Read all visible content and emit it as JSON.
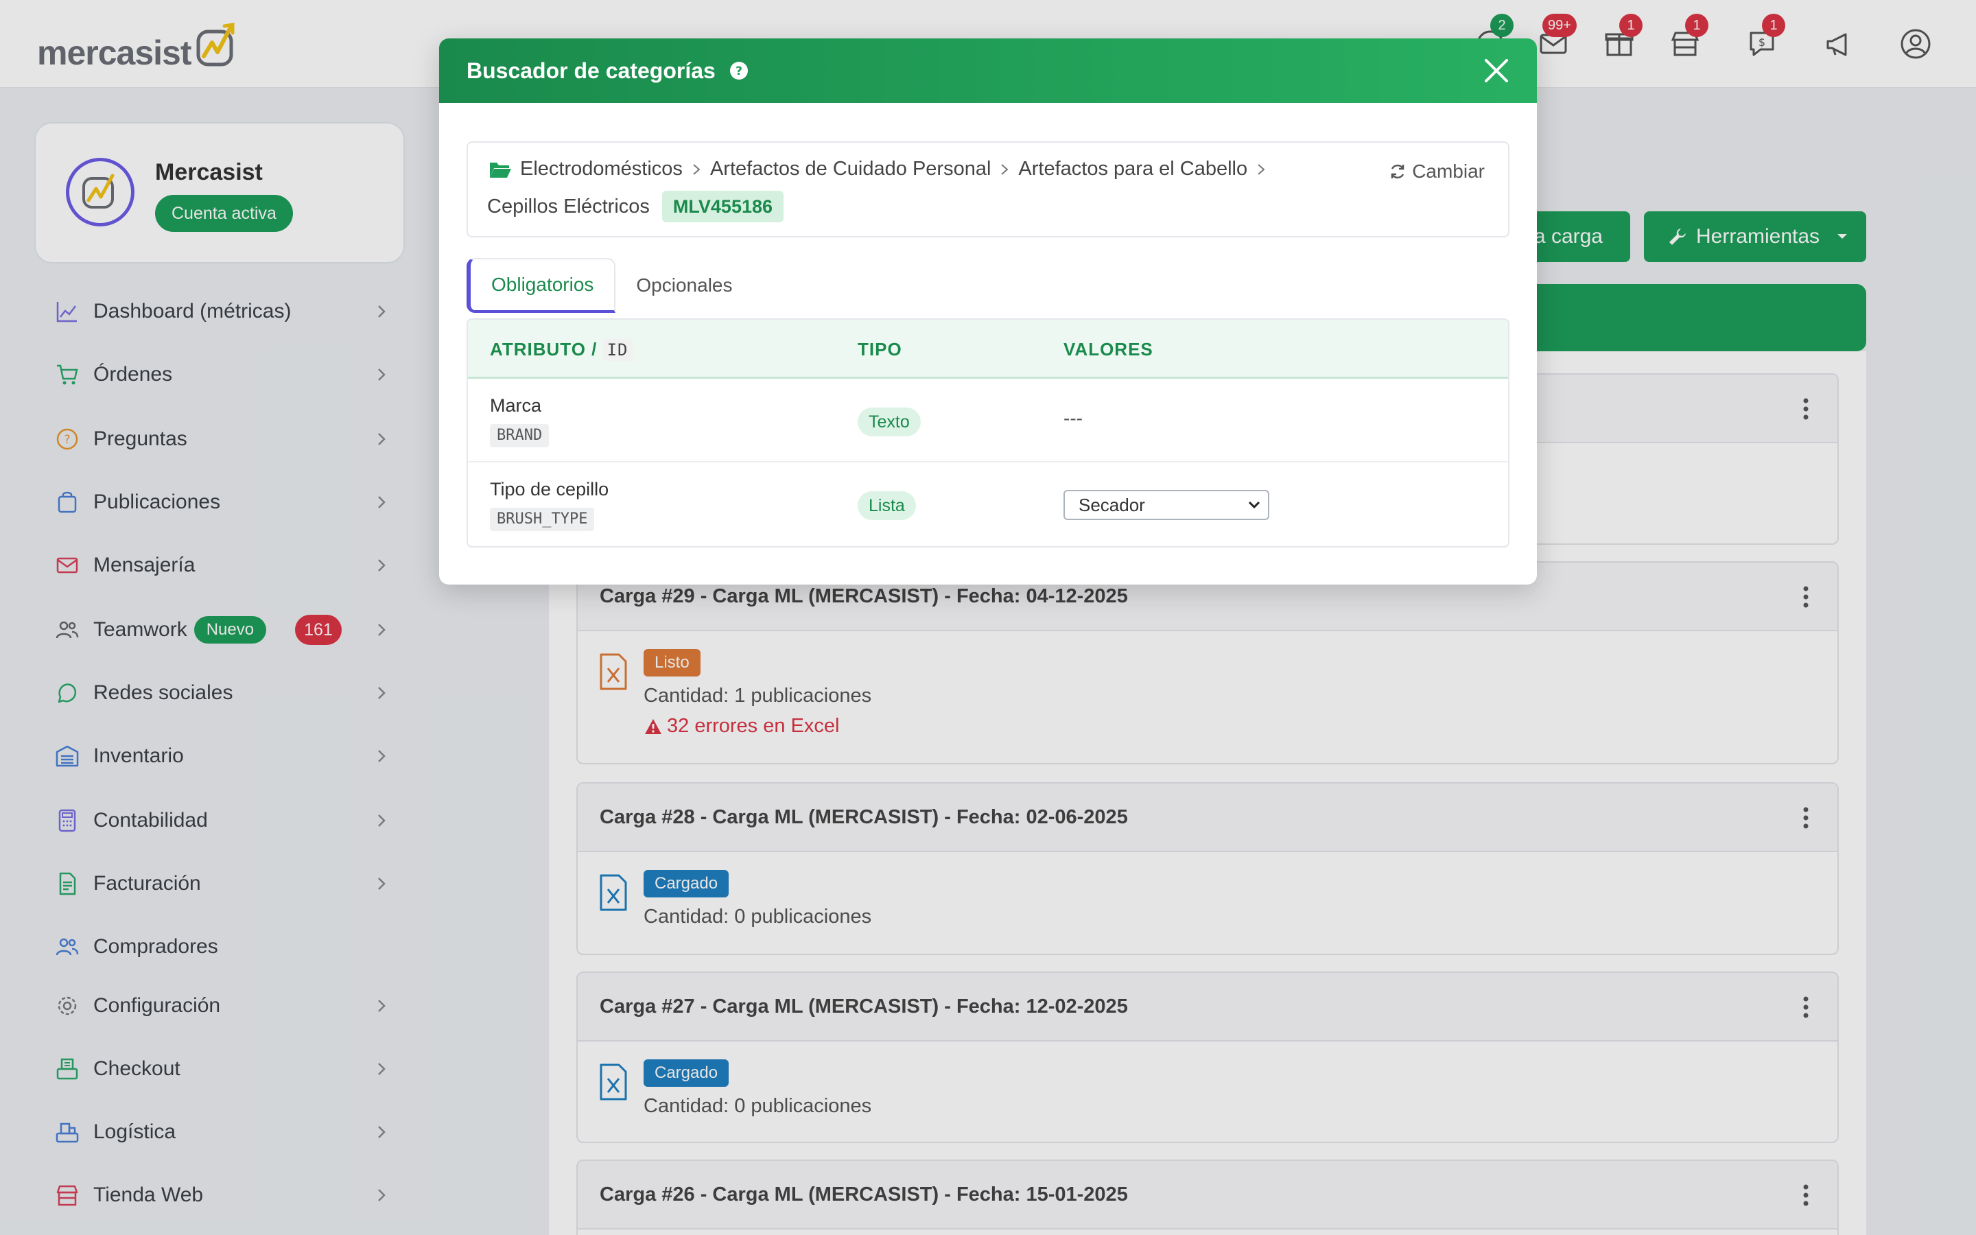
{
  "app": {
    "brand": "mercasist"
  },
  "topbar": {
    "badges": [
      {
        "name": "questions",
        "count": "2",
        "color": "#1e9e5a"
      },
      {
        "name": "messages",
        "count": "99+",
        "color": "#dc3545"
      },
      {
        "name": "box",
        "count": "1",
        "color": "#dc3545"
      },
      {
        "name": "store",
        "count": "1",
        "color": "#dc3545"
      },
      {
        "name": "chat-dollar",
        "count": "1",
        "color": "#dc3545"
      }
    ]
  },
  "profile": {
    "name": "Mercasist",
    "status": "Cuenta activa"
  },
  "sidebar": {
    "items": [
      {
        "label": "Dashboard (métricas)",
        "icon": "chart-line-icon"
      },
      {
        "label": "Órdenes",
        "icon": "cart-icon"
      },
      {
        "label": "Preguntas",
        "icon": "question-circle-icon"
      },
      {
        "label": "Publicaciones",
        "icon": "bag-icon"
      },
      {
        "label": "Mensajería",
        "icon": "envelope-icon"
      },
      {
        "label": "Teamwork",
        "icon": "users-icon",
        "tag": "Nuevo",
        "count": "161"
      },
      {
        "label": "Redes sociales",
        "icon": "whatsapp-icon"
      },
      {
        "label": "Inventario",
        "icon": "warehouse-icon"
      },
      {
        "label": "Contabilidad",
        "icon": "calculator-icon"
      },
      {
        "label": "Facturación",
        "icon": "invoice-icon"
      },
      {
        "label": "Compradores",
        "icon": "buyers-icon"
      },
      {
        "label": "Configuración",
        "icon": "gear-icon"
      },
      {
        "label": "Checkout",
        "icon": "checkout-icon"
      },
      {
        "label": "Logística",
        "icon": "truck-icon"
      },
      {
        "label": "Tienda Web",
        "icon": "shop-icon"
      }
    ]
  },
  "toolbar": {
    "nueva_carga": "a carga",
    "herramientas": "Herramientas"
  },
  "cargas": [
    {
      "title": "Carga #29 - Carga ML (MERCASIST) - Fecha: 04-12-2025",
      "status": "Listo",
      "status_color": "#e07b39",
      "qty": "Cantidad: 1 publicaciones",
      "error": "32 errores en Excel"
    },
    {
      "title": "Carga #28 - Carga ML (MERCASIST) - Fecha: 02-06-2025",
      "status": "Cargado",
      "status_color": "#1f7fc1",
      "qty": "Cantidad: 0 publicaciones"
    },
    {
      "title": "Carga #27 - Carga ML (MERCASIST) - Fecha: 12-02-2025",
      "status": "Cargado",
      "status_color": "#1f7fc1",
      "qty": "Cantidad: 0 publicaciones"
    },
    {
      "title": "Carga #26 - Carga ML (MERCASIST) - Fecha: 15-01-2025"
    }
  ],
  "modal": {
    "title": "Buscador de categorías",
    "breadcrumb": [
      "Electrodomésticos",
      "Artefactos de Cuidado Personal",
      "Artefactos para el Cabello",
      "Cepillos Eléctricos"
    ],
    "category_id": "MLV455186",
    "change_label": "Cambiar",
    "tabs": [
      {
        "label": "Obligatorios",
        "active": true
      },
      {
        "label": "Opcionales",
        "active": false
      }
    ],
    "table": {
      "headers": {
        "attr": "ATRIBUTO /",
        "attr_id": "ID",
        "type": "TIPO",
        "values": "VALORES"
      },
      "rows": [
        {
          "name": "Marca",
          "id": "BRAND",
          "type": "Texto",
          "value": "---"
        },
        {
          "name": "Tipo de cepillo",
          "id": "BRUSH_TYPE",
          "type": "Lista",
          "select_value": "Secador"
        }
      ]
    }
  }
}
